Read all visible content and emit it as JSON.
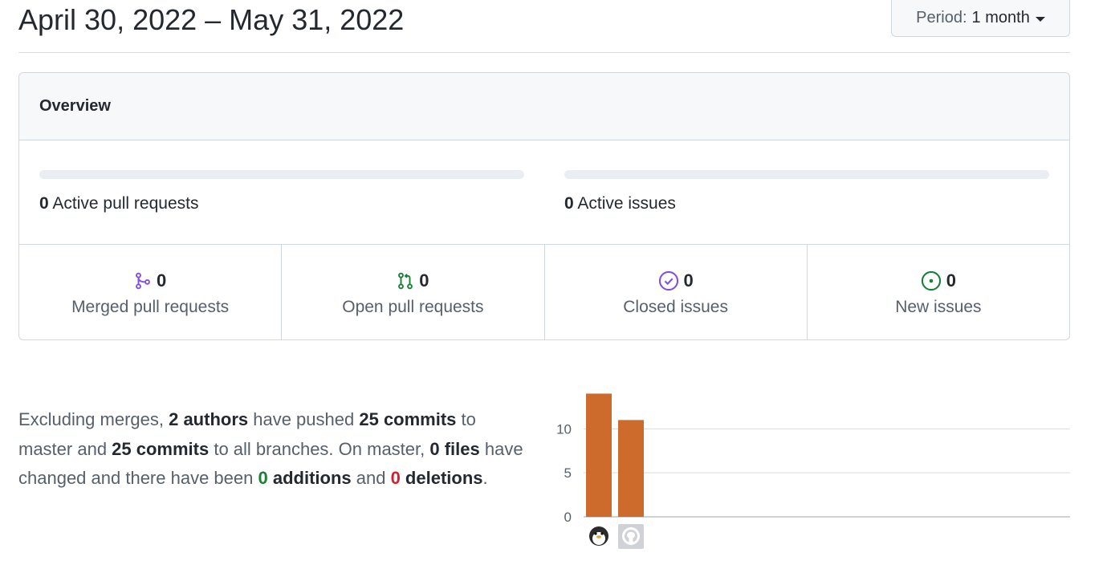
{
  "header": {
    "date_range": "April 30, 2022 – May 31, 2022",
    "period_label": "Period:",
    "period_value": "1 month"
  },
  "overview": {
    "title": "Overview",
    "active_pull_requests": {
      "count": "0",
      "label": "Active pull requests",
      "fill_fraction": 0
    },
    "active_issues": {
      "count": "0",
      "label": "Active issues",
      "fill_fraction": 0
    },
    "cells": [
      {
        "icon": "git-merge-icon",
        "count": "0",
        "label": "Merged pull requests",
        "color": "#8250df"
      },
      {
        "icon": "git-pull-request-icon",
        "count": "0",
        "label": "Open pull requests",
        "color": "#1a7f37"
      },
      {
        "icon": "issue-closed-icon",
        "count": "0",
        "label": "Closed issues",
        "color": "#8250df"
      },
      {
        "icon": "issue-opened-icon",
        "count": "0",
        "label": "New issues",
        "color": "#1a7f37"
      }
    ]
  },
  "summary": {
    "t1": "Excluding merges, ",
    "authors": "2 authors",
    "t2": " have pushed ",
    "commits_master": "25 commits",
    "t3": " to master and ",
    "commits_all": "25 commits",
    "t4": " to all branches. On master, ",
    "files": "0 files",
    "t5": " have changed and there have been ",
    "additions_num": "0",
    "additions_word": " additions",
    "t6": " and ",
    "deletions_num": "0",
    "deletions_word": " deletions",
    "t7": "."
  },
  "chart_data": {
    "type": "bar",
    "categories": [
      "penguin-avatar",
      "github-avatar"
    ],
    "values": [
      14,
      11
    ],
    "yticks": [
      0,
      5,
      10
    ],
    "ylim": [
      0,
      14.5
    ],
    "bar_color": "#cc6b2c",
    "grid": true
  }
}
